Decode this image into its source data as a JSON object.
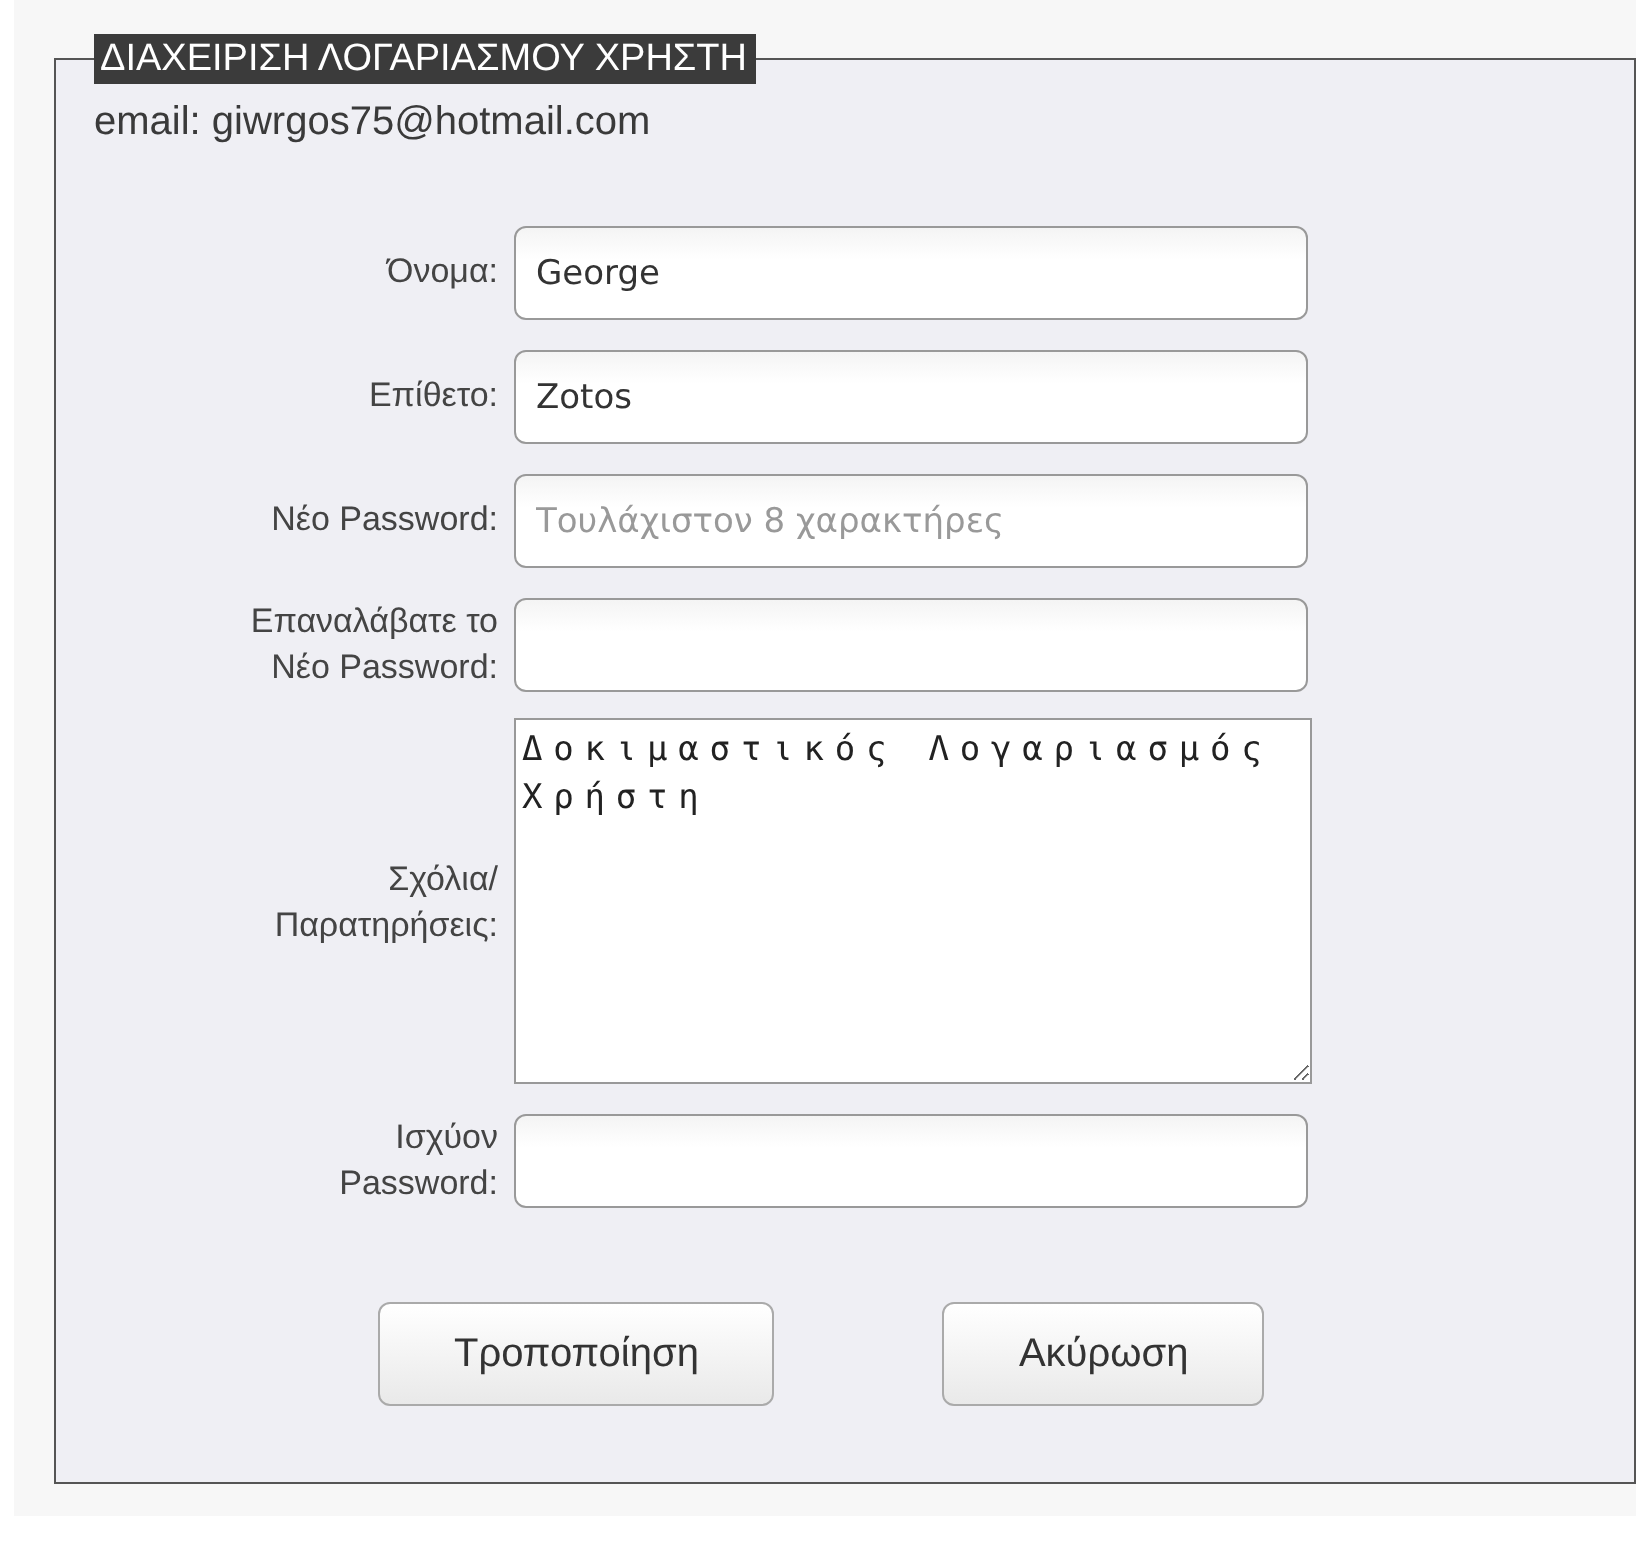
{
  "account_form": {
    "legend": "ΔΙΑΧΕΙΡΙΣΗ ΛΟΓΑΡΙΑΣΜΟΥ ΧΡΗΣΤΗ",
    "email": "email: giwrgos75@hotmail.com"
  },
  "fields": [
    {
      "kind": "text",
      "label": "Όνομα:",
      "value": "George"
    },
    {
      "kind": "text",
      "label": "Επίθετο:",
      "value": "Zotos"
    },
    {
      "kind": "password",
      "label": "Νέο Password:",
      "placeholder": "Τουλάχιστον 8 χαρακτήρες"
    },
    {
      "kind": "password",
      "label": "Επαναλάβατε το\nΝέο Password:"
    },
    {
      "kind": "textarea",
      "label": "Σχόλια/\nΠαρατηρήσεις:",
      "value": "Δοκιμαστικός Λογαριασμός Χρήστη"
    },
    {
      "kind": "password",
      "label": "Ισχύον\nPassword:"
    }
  ],
  "buttons": [
    "Τροποποίηση",
    "Ακύρωση"
  ]
}
